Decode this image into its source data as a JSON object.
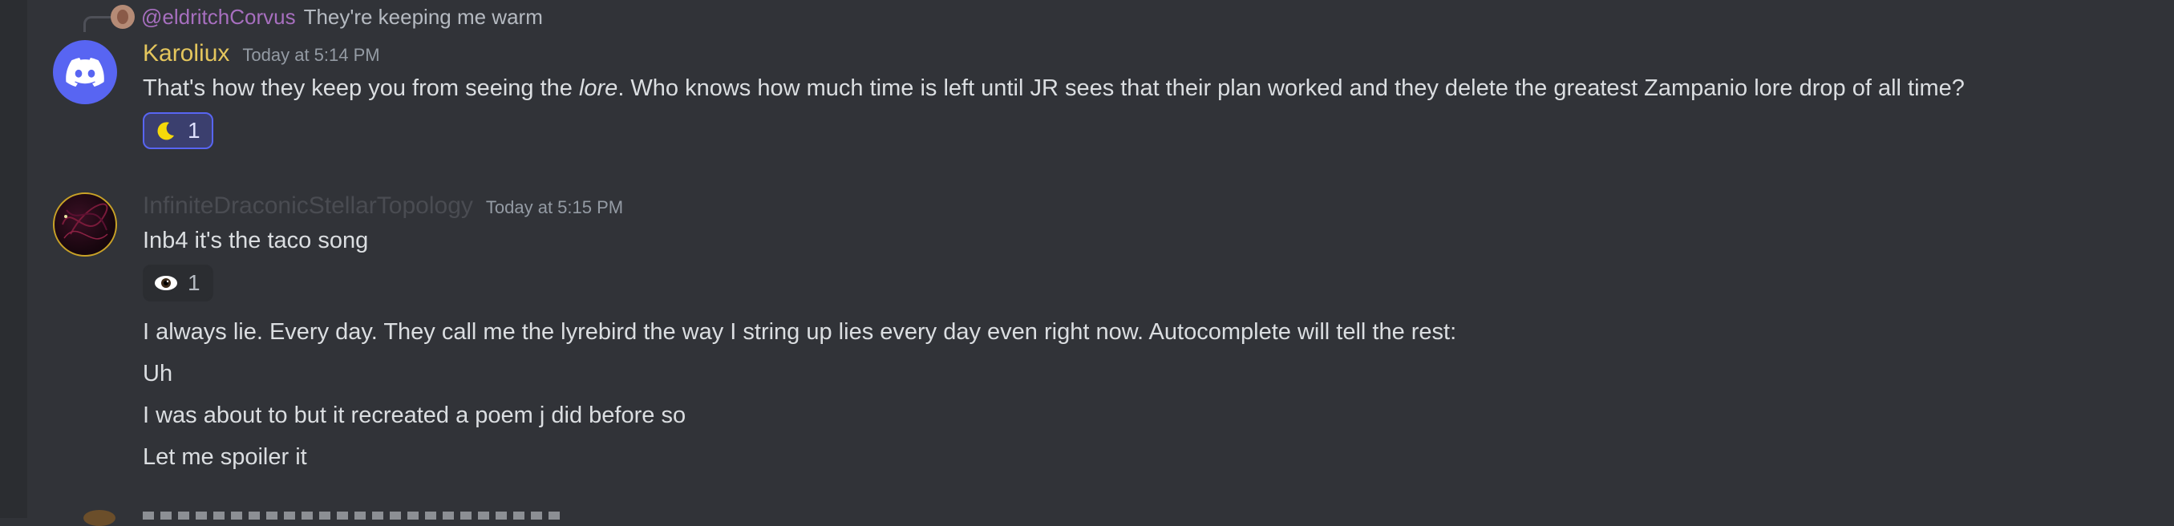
{
  "reply": {
    "username": "@eldritchCorvus",
    "text": "They're keeping me warm"
  },
  "messages": [
    {
      "username": "Karoliux",
      "username_color": "#e4c65d",
      "timestamp": "Today at 5:14 PM",
      "avatar_icon": "discord-logo-icon",
      "text_before": "That's how they keep you from seeing the ",
      "text_em": "lore",
      "text_after": ". Who knows how much time is left until JR sees that their plan worked and they delete the greatest Zampanio lore drop of all time?",
      "reaction": {
        "emoji": "crescent-moon-icon",
        "count": "1",
        "active": true
      }
    },
    {
      "username": "InfiniteDraconicStellarTopology",
      "username_color": "#4a4c52",
      "timestamp": "Today at 5:15 PM",
      "avatar_icon": "topology-avatar",
      "lines": [
        "Inb4 it's the taco song"
      ],
      "reaction": {
        "emoji": "eye-icon",
        "count": "1",
        "active": false
      },
      "followups": [
        "I always lie. Every day. They call me the lyrebird the way I string up lies every day even right now. Autocomplete will tell the rest:",
        "Uh",
        "I was about to but it recreated a poem j did before so",
        "Let me spoiler it"
      ]
    }
  ]
}
